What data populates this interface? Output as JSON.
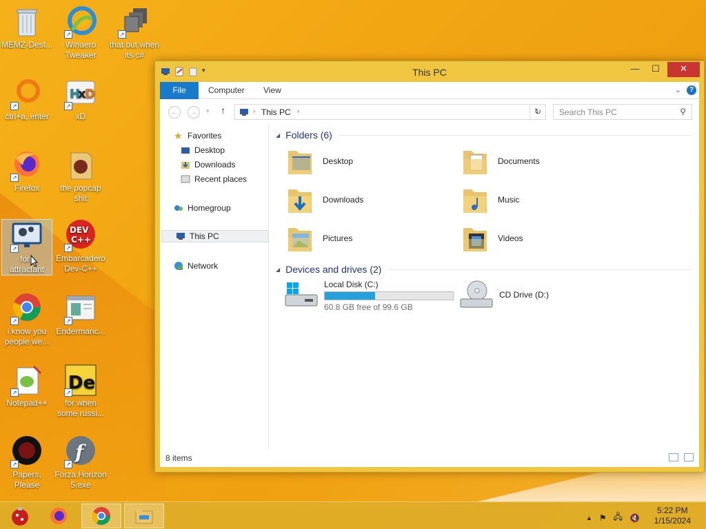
{
  "desktop": {
    "icons": [
      {
        "label": "MEMZ-Dest...",
        "icon": "recycle-bin-icon"
      },
      {
        "label": "Winaero Tweaker",
        "icon": "winaero-icon"
      },
      {
        "label": "that but when its c#",
        "icon": "folder-stack-icon"
      },
      {
        "label": "ctrl+a, enter",
        "icon": "ring-icon"
      },
      {
        "label": "xD",
        "icon": "hxd-icon"
      },
      {
        "label": "Firefox",
        "icon": "firefox-icon"
      },
      {
        "label": "the popcap shit",
        "icon": "popcap-folder-icon"
      },
      {
        "label": "fork attractant",
        "icon": "monitor-gear-icon"
      },
      {
        "label": "Embarcadero Dev-C++",
        "icon": "devcpp-icon"
      },
      {
        "label": "i know you people we...",
        "icon": "chrome-icon"
      },
      {
        "label": "Endermanc...",
        "icon": "window-app-icon"
      },
      {
        "label": "Notepad++",
        "icon": "notepadpp-icon"
      },
      {
        "label": "for when some russi...",
        "icon": "de-icon"
      },
      {
        "label": "Papers, Please",
        "icon": "papers-please-icon"
      },
      {
        "label": "Forza Horizon 5.exe",
        "icon": "flash-icon"
      }
    ]
  },
  "window": {
    "title": "This PC",
    "ribbon": {
      "file": "File",
      "computer": "Computer",
      "view": "View",
      "help": "?"
    },
    "address": {
      "crumb": "This PC"
    },
    "search": {
      "placeholder": "Search This PC"
    },
    "nav": {
      "favorites": "Favorites",
      "desktop": "Desktop",
      "downloads": "Downloads",
      "recent": "Recent places",
      "homegroup": "Homegroup",
      "thispc": "This PC",
      "network": "Network"
    },
    "folders_header": "Folders (6)",
    "folders": [
      "Desktop",
      "Documents",
      "Downloads",
      "Music",
      "Pictures",
      "Videos"
    ],
    "devices_header": "Devices and drives (2)",
    "drives": {
      "local": {
        "name": "Local Disk (C:)",
        "free": "60.8 GB free of 99.6 GB",
        "used_fraction": 0.39
      },
      "cd": {
        "name": "CD Drive (D:)"
      }
    },
    "status": "8 items"
  },
  "taskbar": {
    "clock_time": "5:22 PM",
    "clock_date": "1/15/2024"
  },
  "colors": {
    "accent": "#1979ca",
    "folder_header": "#1e3287",
    "progress": "#26a0da",
    "close": "#c7372f"
  }
}
